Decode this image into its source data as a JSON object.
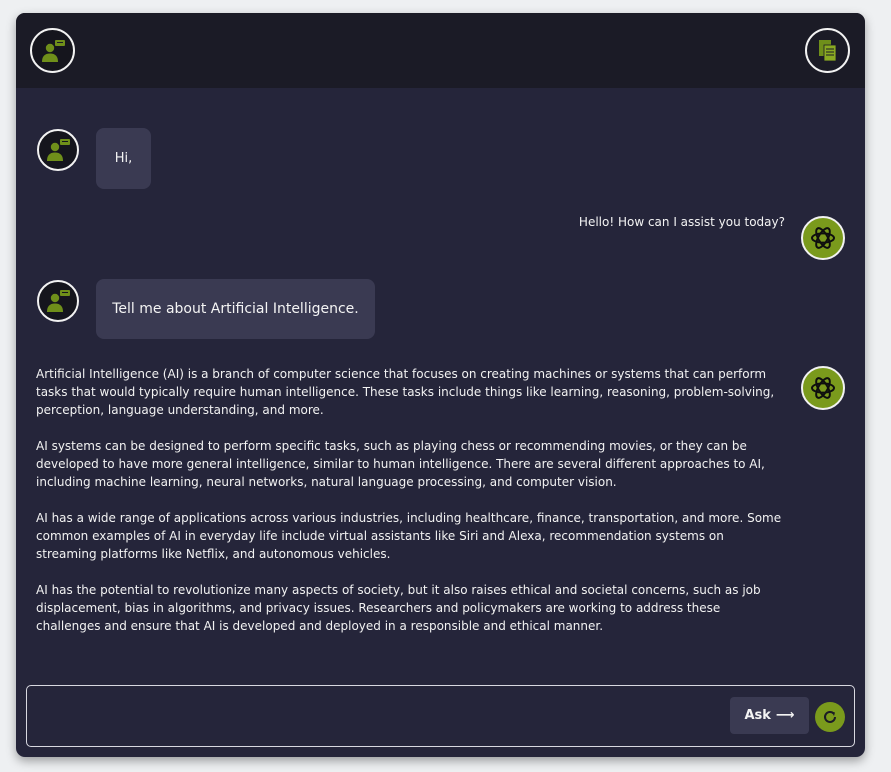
{
  "conversation": [
    {
      "role": "user",
      "text": "Hi,"
    },
    {
      "role": "assistant",
      "text": "Hello! How can I assist you today?"
    },
    {
      "role": "user",
      "text": "Tell me about Artificial Intelligence."
    },
    {
      "role": "assistant",
      "paragraphs": [
        "Artificial Intelligence (AI) is a branch of computer science that focuses on creating machines or systems that can perform tasks that would typically require human intelligence. These tasks include things like learning, reasoning, problem-solving, perception, language understanding, and more.",
        "AI systems can be designed to perform specific tasks, such as playing chess or recommending movies, or they can be developed to have more general intelligence, similar to human intelligence. There are several different approaches to AI, including machine learning, neural networks, natural language processing, and computer vision.",
        "AI has a wide range of applications across various industries, including healthcare, finance, transportation, and more. Some common examples of AI in everyday life include virtual assistants like Siri and Alexa, recommendation systems on streaming platforms like Netflix, and autonomous vehicles.",
        "AI has the potential to revolutionize many aspects of society, but it also raises ethical and societal concerns, such as job displacement, bias in algorithms, and privacy issues. Researchers and policymakers are working to address these challenges and ensure that AI is developed and deployed in a responsible and ethical manner."
      ]
    }
  ],
  "input": {
    "value": "",
    "placeholder": ""
  },
  "ask_button": {
    "label": "Ask",
    "arrow": "⟶"
  },
  "icons": {
    "user": "user-speaking-icon",
    "assistant": "openai-logo-icon",
    "header_right": "documents-icon",
    "refresh": "refresh-icon"
  },
  "colors": {
    "background": "#25253a",
    "header": "#1b1b26",
    "bubble": "#3a3a52",
    "accent": "#7a9a1c"
  }
}
